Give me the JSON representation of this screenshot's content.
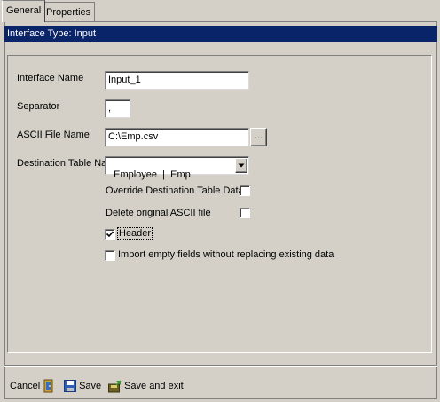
{
  "tabs": [
    {
      "label": "General",
      "active": true
    },
    {
      "label": "Properties",
      "active": false
    }
  ],
  "title_bar": "Interface Type: Input",
  "form": {
    "interface_name_label": "Interface Name",
    "interface_name_value": "Input_1",
    "separator_label": "Separator",
    "separator_value": ",",
    "ascii_file_label": "ASCII File Name",
    "ascii_file_value": "C:\\Emp.csv",
    "browse_label": "...",
    "destination_label": "Destination Table Name",
    "destination_value": "Employee  |  Emp"
  },
  "options": [
    {
      "label": "Override Destination Table Data",
      "checked": false
    },
    {
      "label": "Delete original ASCII file",
      "checked": false
    },
    {
      "label": "Header",
      "checked": true
    },
    {
      "label": "Import empty fields without replacing existing data",
      "checked": false
    }
  ],
  "footer": {
    "cancel": "Cancel",
    "save": "Save",
    "save_exit": "Save and exit"
  },
  "colors": {
    "title_bar_bg": "#0a246a",
    "window_bg": "#d4d0c8"
  },
  "icons": {
    "cancel": "exit-door-icon",
    "save": "floppy-disk-icon",
    "save_exit": "save-exit-icon",
    "dropdown": "dropdown-arrow-icon"
  }
}
